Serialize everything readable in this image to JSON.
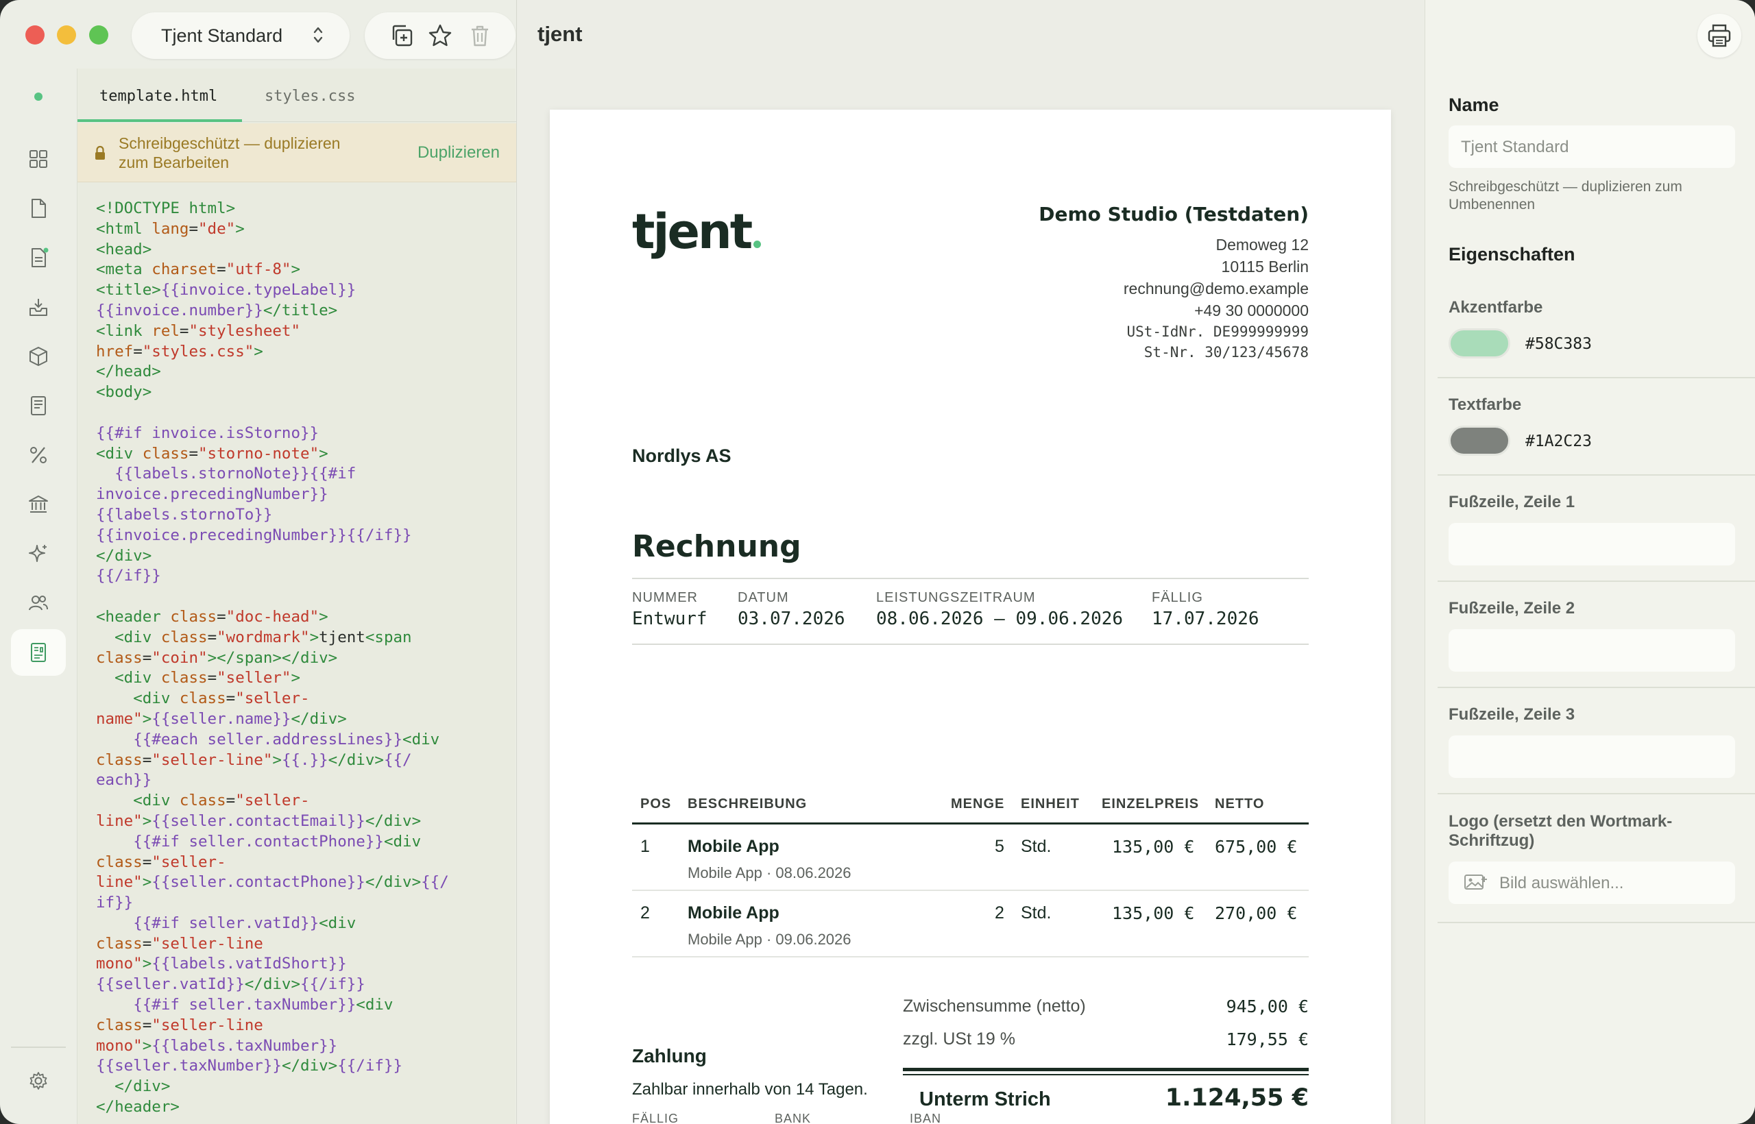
{
  "toolbar": {
    "template_name": "Tjent Standard"
  },
  "editor": {
    "tabs": [
      "template.html",
      "styles.css"
    ],
    "banner_text": "Schreibgeschützt — duplizieren zum Bearbeiten",
    "banner_action": "Duplizieren"
  },
  "canvas": {
    "title": "tjent"
  },
  "invoice": {
    "wordmark": "tjent",
    "seller": {
      "name": "Demo Studio (Testdaten)",
      "address": [
        "Demoweg 12",
        "10115 Berlin"
      ],
      "email": "rechnung@demo.example",
      "phone": "+49 30 0000000",
      "vat": "USt-IdNr. DE999999999",
      "tax": "St-Nr. 30/123/45678"
    },
    "buyer": "Nordlys AS",
    "doc_title": "Rechnung",
    "meta": [
      {
        "label": "NUMMER",
        "value": "Entwurf"
      },
      {
        "label": "DATUM",
        "value": "03.07.2026"
      },
      {
        "label": "LEISTUNGSZEITRAUM",
        "value": "08.06.2026 – 09.06.2026"
      },
      {
        "label": "FÄLLIG",
        "value": "17.07.2026"
      }
    ],
    "table_headers": [
      "POS",
      "BESCHREIBUNG",
      "MENGE",
      "EINHEIT",
      "EINZELPREIS",
      "NETTO"
    ],
    "items": [
      {
        "pos": "1",
        "desc": "Mobile App",
        "sub": "Mobile App · 08.06.2026",
        "qty": "5",
        "unit": "Std.",
        "price": "135,00 €",
        "net": "675,00 €"
      },
      {
        "pos": "2",
        "desc": "Mobile App",
        "sub": "Mobile App · 09.06.2026",
        "qty": "2",
        "unit": "Std.",
        "price": "135,00 €",
        "net": "270,00 €"
      }
    ],
    "subtotal_label": "Zwischensumme (netto)",
    "subtotal": "945,00 €",
    "vat_label": "zzgl. USt 19 %",
    "vat_amount": "179,55 €",
    "total_label": "Unterm Strich",
    "total": "1.124,55 €",
    "payment_title": "Zahlung",
    "payment_text": "Zahlbar innerhalb von 14 Tagen.",
    "payment_labels": [
      "FÄLLIG",
      "BANK",
      "IBAN"
    ]
  },
  "inspector": {
    "name_heading": "Name",
    "name_value": "Tjent Standard",
    "name_hint": "Schreibgeschützt — duplizieren zum Umbenennen",
    "props_heading": "Eigenschaften",
    "accent_label": "Akzentfarbe",
    "accent_hex": "#58C383",
    "text_label": "Textfarbe",
    "text_hex": "#1A2C23",
    "footer1_label": "Fußzeile, Zeile 1",
    "footer2_label": "Fußzeile, Zeile 2",
    "footer3_label": "Fußzeile, Zeile 3",
    "logo_label": "Logo (ersetzt den Wortmark-Schriftzug)",
    "logo_placeholder": "Bild auswählen..."
  },
  "colors": {
    "accent": "#58C383",
    "text": "#1A2C23",
    "accent_swatch": "#a9dcb9",
    "text_swatch": "#7e827d"
  },
  "icons": [
    "copy-icon",
    "star-icon",
    "trash-icon",
    "grid-icon",
    "document-icon",
    "invoice-icon",
    "inbox-icon",
    "box-icon",
    "receipt-icon",
    "percent-icon",
    "bank-icon",
    "sparkle-icon",
    "users-icon",
    "template-icon",
    "gear-icon",
    "print-icon",
    "lock-icon",
    "image-icon"
  ]
}
